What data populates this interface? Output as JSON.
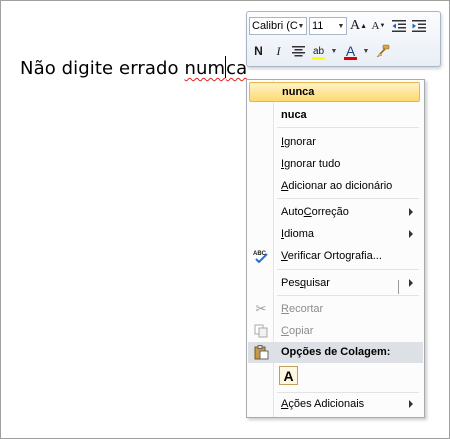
{
  "document": {
    "text_before": "Não digite errado ",
    "misspelled_part1": "num",
    "misspelled_part2": "ca"
  },
  "mini_toolbar": {
    "font_name": "Calibri (C",
    "font_size": "11",
    "grow_font": "A",
    "shrink_font": "A",
    "bold": "N",
    "italic": "I",
    "highlight_color": "#ffff00",
    "font_color_glyph": "A",
    "font_color": "#e00000"
  },
  "context_menu": {
    "suggestions": [
      "nunca",
      "nuca"
    ],
    "items": {
      "ignore": {
        "pre": "",
        "ul": "I",
        "post": "gnorar"
      },
      "ignore_all": {
        "pre": "",
        "ul": "I",
        "post": "gnorar tudo"
      },
      "add_dict": {
        "pre": "",
        "ul": "A",
        "post": "dicionar ao dicionário"
      },
      "autocorrect": {
        "pre": "Auto",
        "ul": "C",
        "post": "orreção"
      },
      "language": {
        "pre": "",
        "ul": "I",
        "post": "dioma"
      },
      "spell_check": {
        "pre": "",
        "ul": "V",
        "post": "erificar Ortografia..."
      },
      "search": {
        "pre": "Pes",
        "ul": "q",
        "post": "uisar"
      },
      "cut": {
        "pre": "",
        "ul": "R",
        "post": "ecortar"
      },
      "copy": {
        "pre": "",
        "ul": "C",
        "post": "opiar"
      },
      "paste_options": "Opções de Colagem:",
      "paste_keep_text": "A",
      "more_actions": {
        "pre": "",
        "ul": "A",
        "post": "ções Adicionais"
      }
    }
  },
  "colors": {
    "highlight_start": "#fff3c8",
    "highlight_end": "#ffd970",
    "section_bg": "#dde1e6",
    "spell_underline": "#e02020"
  }
}
